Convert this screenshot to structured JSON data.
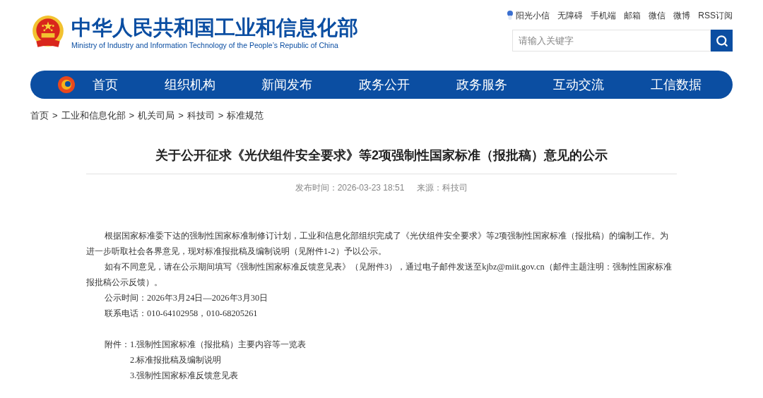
{
  "header": {
    "title_cn": "中华人民共和国工业和信息化部",
    "title_en": "Ministry of Industry and Information Technology of the People’s Republic of China"
  },
  "top_links": [
    "阳光小信",
    "无障碍",
    "手机端",
    "邮箱",
    "微信",
    "微博",
    "RSS订阅"
  ],
  "search": {
    "placeholder": "请输入关键字"
  },
  "nav": [
    {
      "label": "首页",
      "selected": false
    },
    {
      "label": "组织机构",
      "selected": false
    },
    {
      "label": "新闻发布",
      "selected": false
    },
    {
      "label": "政务公开",
      "selected": false
    },
    {
      "label": "政务服务",
      "selected": false
    },
    {
      "label": "互动交流",
      "selected": false
    },
    {
      "label": "工信数据",
      "selected": false
    }
  ],
  "breadcrumb_separator": ">",
  "breadcrumb": [
    "首页",
    "工业和信息化部",
    "机关司局",
    "科技司",
    "标准规范"
  ],
  "article": {
    "title": "关于公开征求《光伏组件安全要求》等2项强制性国家标准（报批稿）意见的公示",
    "published": "发布时间：2026-03-23 18:51",
    "source": "来源：科技司",
    "paragraphs": [
      "根据国家标准委下达的强制性国家标准制修订计划，工业和信息化部组织完成了《光伏组件安全要求》等2项强制性国家标准（报批稿）的编制工作。为进一步听取社会各界意见，现对标准报批稿及编制说明（见附件1-2）予以公示。",
      "如有不同意见，请在公示期间填写《强制性国家标准反馈意见表》（见附件3），通过电子邮件发送至kjbz@miit.gov.cn（邮件主题注明：强制性国家标准报批稿公示反馈）。",
      "公示时间：2026年3月24日—2026年3月30日",
      "联系电话：010-64102958，010-68205261"
    ],
    "attachments": {
      "label": "附件：",
      "items": [
        "1.强制性国家标准（报批稿）主要内容等一览表",
        "2.标准报批稿及编制说明",
        "3.强制性国家标准反馈意见表"
      ]
    }
  }
}
